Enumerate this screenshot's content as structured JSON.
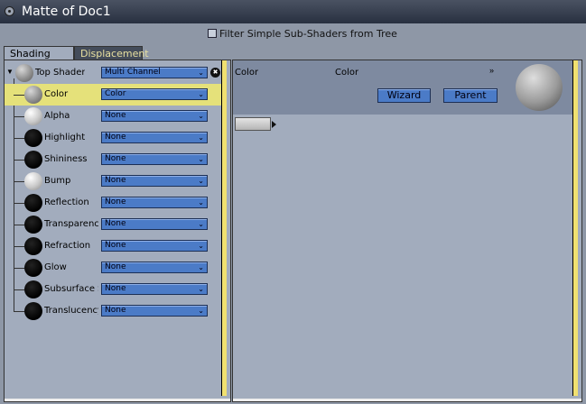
{
  "window": {
    "title": "Matte of Doc1"
  },
  "filter": {
    "label": "Filter Simple Sub-Shaders from Tree",
    "checked": false
  },
  "tabs": [
    {
      "label": "Shading",
      "active": true
    },
    {
      "label": "Displacement",
      "active": false
    }
  ],
  "tree": {
    "top": {
      "label": "Top Shader",
      "value": "Multi Channel"
    },
    "items": [
      {
        "label": "Color",
        "value": "Color",
        "ball": "gray",
        "selected": true
      },
      {
        "label": "Alpha",
        "value": "None",
        "ball": "white",
        "selected": false
      },
      {
        "label": "Highlight",
        "value": "None",
        "ball": "black",
        "selected": false
      },
      {
        "label": "Shininess",
        "value": "None",
        "ball": "black",
        "selected": false
      },
      {
        "label": "Bump",
        "value": "None",
        "ball": "white",
        "selected": false
      },
      {
        "label": "Reflection",
        "value": "None",
        "ball": "black",
        "selected": false
      },
      {
        "label": "Transparency",
        "value": "None",
        "ball": "black",
        "selected": false
      },
      {
        "label": "Refraction",
        "value": "None",
        "ball": "black",
        "selected": false
      },
      {
        "label": "Glow",
        "value": "None",
        "ball": "black",
        "selected": false
      },
      {
        "label": "Subsurface Sc",
        "value": "None",
        "ball": "black",
        "selected": false
      },
      {
        "label": "Translucency",
        "value": "None",
        "ball": "black",
        "selected": false
      }
    ]
  },
  "editor": {
    "channel_label": "Color",
    "type_label": "Color",
    "wizard_button": "Wizard",
    "parent_button": "Parent"
  },
  "icons": {
    "close": "close-icon",
    "trash": "trash-icon",
    "dropdown": "chevron-down-icon",
    "collapse": "double-chevron-icon"
  },
  "colors": {
    "selected_row": "#e5e17a",
    "dropdown": "#4b7bc7",
    "panel": "#a2acbd",
    "scroll_thumb": "#f0e070"
  }
}
